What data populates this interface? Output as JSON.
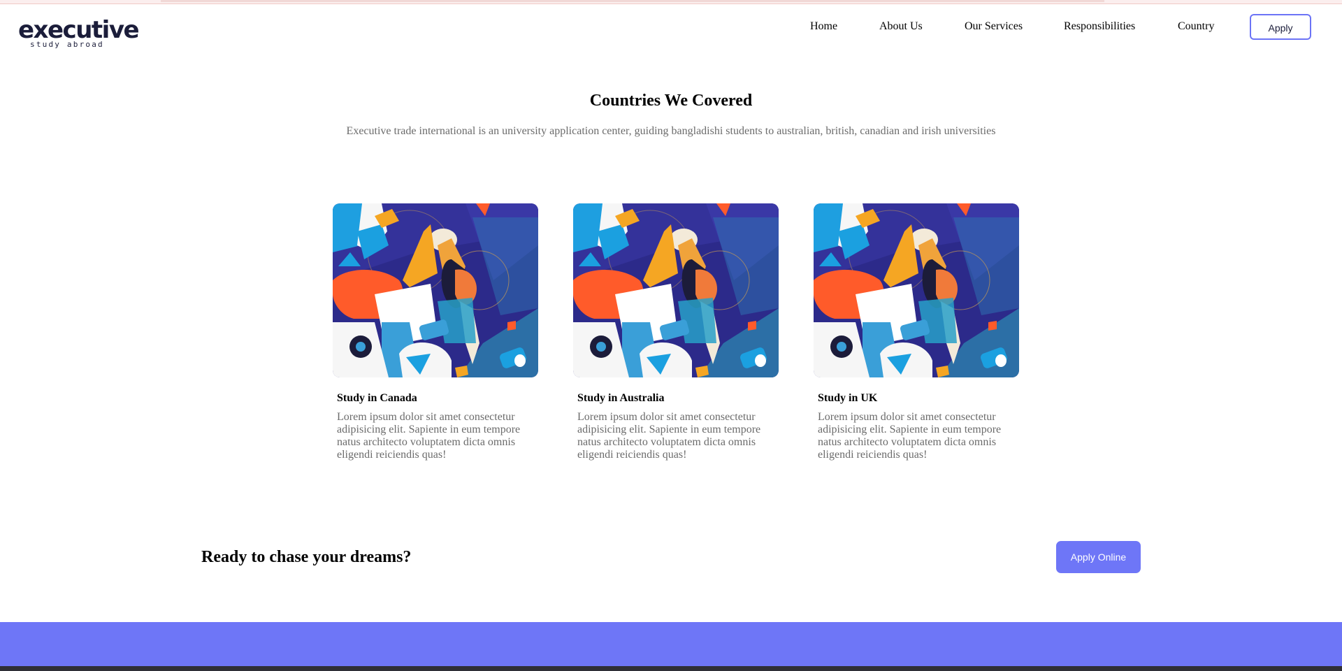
{
  "brand": {
    "name": "executive",
    "tagline": "study abroad",
    "color": "#1b1d3a"
  },
  "nav": {
    "links": [
      "Home",
      "About Us",
      "Our Services",
      "Responsibilities",
      "Country"
    ],
    "apply_label": "Apply"
  },
  "countries": {
    "title": "Countries We Covered",
    "subtitle": "Executive trade international is an university application center, guiding bangladishi students to australian, british, canadian and irish universities",
    "cards": [
      {
        "title": "Study in Canada",
        "text": "Lorem ipsum dolor sit amet consectetur adipisicing elit. Sapiente in eum tempore natus architecto voluptatem dicta omnis eligendi reiciendis quas!"
      },
      {
        "title": "Study in Australia",
        "text": "Lorem ipsum dolor sit amet consectetur adipisicing elit. Sapiente in eum tempore natus architecto voluptatem dicta omnis eligendi reiciendis quas!"
      },
      {
        "title": "Study in UK",
        "text": "Lorem ipsum dolor sit amet consectetur adipisicing elit. Sapiente in eum tempore natus architecto voluptatem dicta omnis eligendi reiciendis quas!"
      }
    ]
  },
  "cta": {
    "title": "Ready to chase your dreams?",
    "button_label": "Apply Online"
  },
  "colors": {
    "accent": "#6e76f7",
    "muted_text": "#6b6b6b"
  }
}
